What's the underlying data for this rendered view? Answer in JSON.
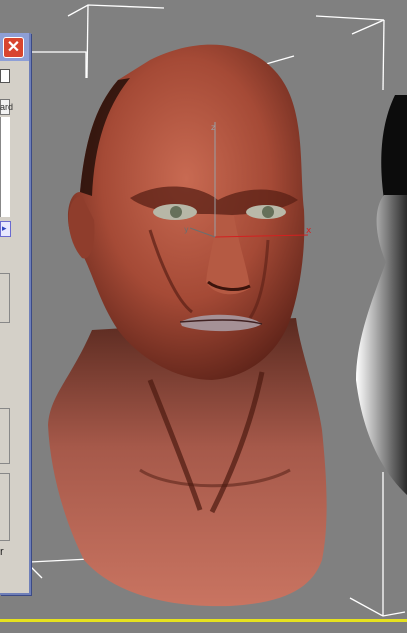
{
  "window": {
    "close_glyph": "✕"
  },
  "panel": {
    "field2_label": "ard",
    "dropdown_glyph": "▸",
    "bottom_label": "r"
  },
  "colors": {
    "viewport_bg": "#808080",
    "panel_bg": "#d4d0c8",
    "panel_border": "#6f7fb8",
    "close_button": "#d8452f",
    "gizmo_x": "#d42020",
    "gizmo_z": "#9aa0a6",
    "skin": "#a4503a",
    "bounding_box": "#ffffff",
    "selection_line": "#e6e21f"
  }
}
